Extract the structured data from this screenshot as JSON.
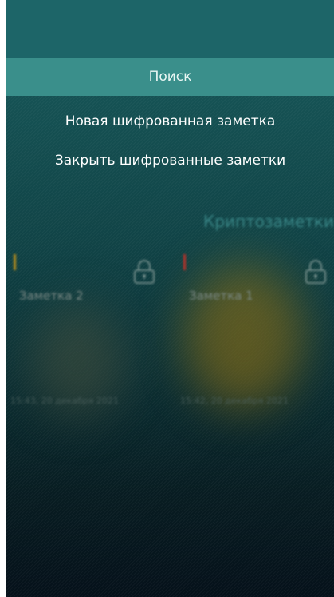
{
  "menu": {
    "search_label": "Поиск",
    "new_note_label": "Новая шифрованная заметка",
    "close_notes_label": "Закрыть шифрованные заметки"
  },
  "app": {
    "title": "Криптозаметки"
  },
  "notes": [
    {
      "title": "Заметка 2",
      "date": "15:43, 20 декабря 2021",
      "marker_color": "#b08a1e",
      "locked": true
    },
    {
      "title": "Заметка 1",
      "date": "15:42, 20 декабря 2021",
      "marker_color": "#b8322a",
      "locked": true
    }
  ],
  "icons": {
    "lock": "lock-icon"
  },
  "colors": {
    "menu_highlight": "#3a8f8b",
    "background_top": "#185a5d",
    "background_bottom": "#05111a"
  }
}
